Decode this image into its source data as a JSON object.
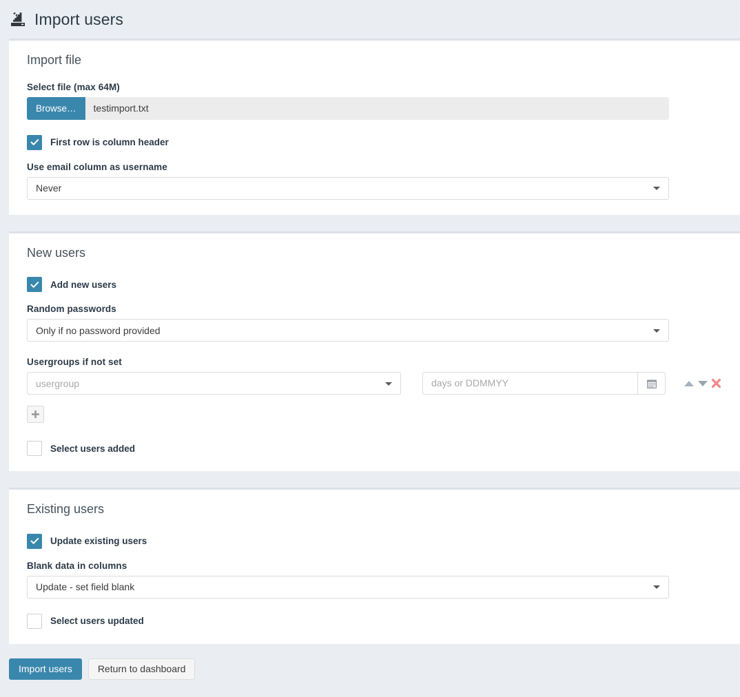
{
  "header": {
    "icon": "import-users-icon",
    "title": "Import users"
  },
  "panels": {
    "import_file": {
      "heading": "Import file",
      "select_file_label": "Select file (max 64M)",
      "browse_button": "Browse…",
      "file_name": "testimport.txt",
      "first_row_checkbox": {
        "label": "First row is column header",
        "checked": true
      },
      "email_username_label": "Use email column as username",
      "email_username_value": "Never"
    },
    "new_users": {
      "heading": "New users",
      "add_new_checkbox": {
        "label": "Add new users",
        "checked": true
      },
      "random_passwords_label": "Random passwords",
      "random_passwords_value": "Only if no password provided",
      "usergroups_label": "Usergroups if not set",
      "usergroup_placeholder": "usergroup",
      "duration_placeholder": "days or DDMMYY",
      "calendar_icon": "calendar-icon",
      "move_up_icon": "arrow-up-icon",
      "move_down_icon": "arrow-down-icon",
      "remove_icon": "remove-x-icon",
      "add_row_icon": "plus-icon",
      "select_added_checkbox": {
        "label": "Select users added",
        "checked": false
      }
    },
    "existing_users": {
      "heading": "Existing users",
      "update_existing_checkbox": {
        "label": "Update existing users",
        "checked": true
      },
      "blank_data_label": "Blank data in columns",
      "blank_data_value": "Update - set field blank",
      "select_updated_checkbox": {
        "label": "Select users updated",
        "checked": false
      }
    }
  },
  "footer": {
    "submit_label": "Import users",
    "cancel_label": "Return to dashboard"
  },
  "colors": {
    "accent": "#3a87ad",
    "page_background": "#eaeef2",
    "panel_background": "#ffffff",
    "panel_border": "#dde1e7",
    "danger": "#f08a8a",
    "text": "#2b3a47"
  }
}
